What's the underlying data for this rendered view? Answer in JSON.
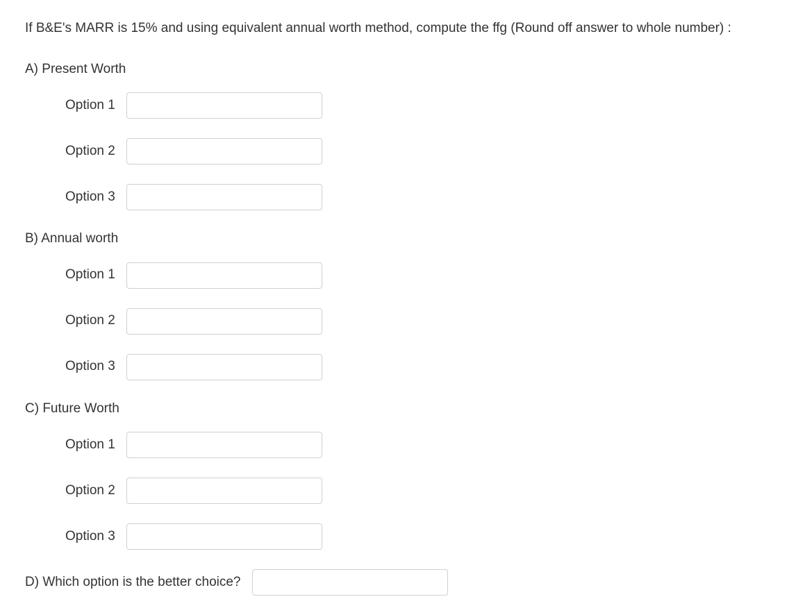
{
  "question": "If B&E's MARR is 15% and using equivalent annual worth method, compute the ffg (Round off answer to whole number) :",
  "sections": {
    "a": {
      "label": "A) Present Worth",
      "options": {
        "opt1": "Option 1",
        "opt2": "Option 2",
        "opt3": "Option 3"
      }
    },
    "b": {
      "label": "B) Annual worth",
      "options": {
        "opt1": "Option 1",
        "opt2": "Option 2",
        "opt3": "Option 3"
      }
    },
    "c": {
      "label": "C) Future Worth",
      "options": {
        "opt1": "Option 1",
        "opt2": "Option 2",
        "opt3": "Option 3"
      }
    },
    "d": {
      "label": "D)  Which option is the better choice?"
    }
  }
}
